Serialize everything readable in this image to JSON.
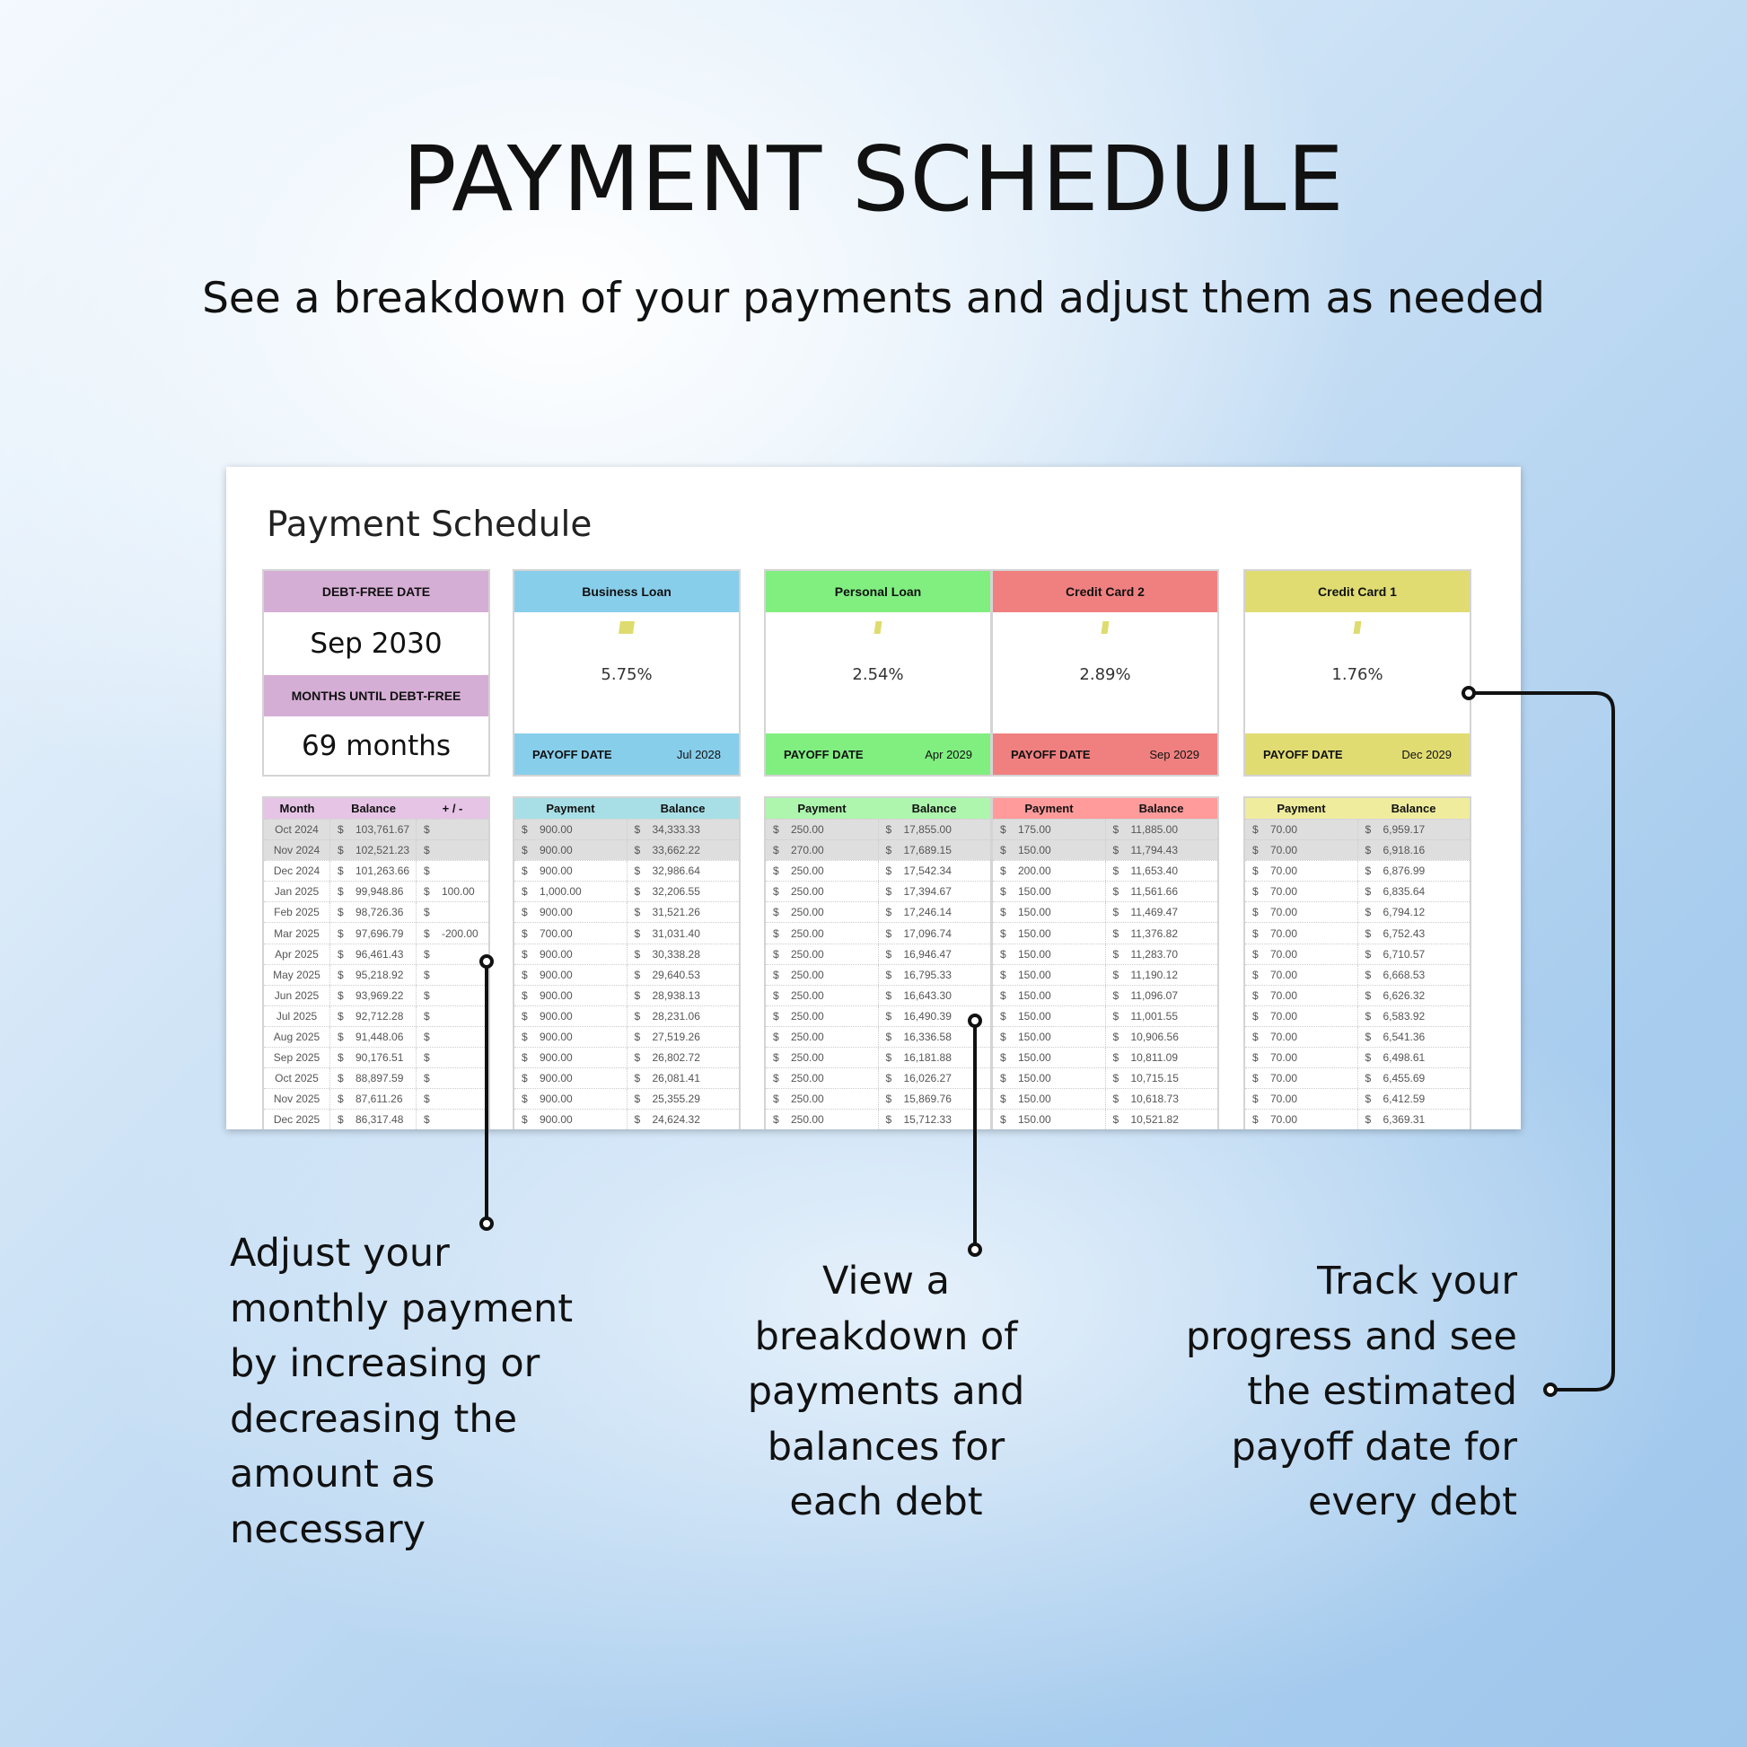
{
  "header": {
    "title": "PAYMENT SCHEDULE",
    "subtitle": "See a breakdown of your payments and adjust them as needed"
  },
  "sheet": {
    "title": "Payment Schedule",
    "summary": {
      "debt_free_label": "DEBT-FREE DATE",
      "debt_free_value": "Sep 2030",
      "months_label": "MONTHS UNTIL DEBT-FREE",
      "months_value": "69 months",
      "color": "#d5aed5",
      "table_color": "#e6c4e6"
    },
    "payoff_label": "PAYOFF DATE",
    "debts": [
      {
        "name": "Business Loan",
        "rate": "5.75%",
        "payoff": "Jul 2028",
        "color": "#87ceeb",
        "table_color": "#a8dfe6",
        "progress_gauge_color": "#dedc6e"
      },
      {
        "name": "Personal Loan",
        "rate": "2.54%",
        "payoff": "Apr 2029",
        "color": "#80ef80",
        "table_color": "#aef5ae",
        "progress_gauge_color": "#dedc6e"
      },
      {
        "name": "Credit Card 2",
        "rate": "2.89%",
        "payoff": "Sep 2029",
        "color": "#f08080",
        "table_color": "#ff9b9b",
        "progress_gauge_color": "#dedc6e"
      },
      {
        "name": "Credit Card 1",
        "rate": "1.76%",
        "payoff": "Dec 2029",
        "color": "#e0dc72",
        "table_color": "#efec9e",
        "progress_gauge_color": "#dedc6e"
      }
    ],
    "summary_table": {
      "headers": [
        "Month",
        "Balance",
        "+ / -"
      ],
      "currency": "$",
      "rows": [
        [
          "Oct 2024",
          "103,761.67",
          ""
        ],
        [
          "Nov 2024",
          "102,521.23",
          ""
        ],
        [
          "Dec 2024",
          "101,263.66",
          ""
        ],
        [
          "Jan 2025",
          "99,948.86",
          "100.00"
        ],
        [
          "Feb 2025",
          "98,726.36",
          ""
        ],
        [
          "Mar 2025",
          "97,696.79",
          "-200.00"
        ],
        [
          "Apr 2025",
          "96,461.43",
          ""
        ],
        [
          "May 2025",
          "95,218.92",
          ""
        ],
        [
          "Jun 2025",
          "93,969.22",
          ""
        ],
        [
          "Jul 2025",
          "92,712.28",
          ""
        ],
        [
          "Aug 2025",
          "91,448.06",
          ""
        ],
        [
          "Sep 2025",
          "90,176.51",
          ""
        ],
        [
          "Oct 2025",
          "88,897.59",
          ""
        ],
        [
          "Nov 2025",
          "87,611.26",
          ""
        ],
        [
          "Dec 2025",
          "86,317.48",
          ""
        ]
      ]
    },
    "debt_table_headers": [
      "Payment",
      "Balance"
    ],
    "debt_tables": [
      {
        "payments": [
          "900.00",
          "900.00",
          "900.00",
          "1,000.00",
          "900.00",
          "700.00",
          "900.00",
          "900.00",
          "900.00",
          "900.00",
          "900.00",
          "900.00",
          "900.00",
          "900.00",
          "900.00"
        ],
        "balances": [
          "34,333.33",
          "33,662.22",
          "32,986.64",
          "32,206.55",
          "31,521.26",
          "31,031.40",
          "30,338.28",
          "29,640.53",
          "28,938.13",
          "28,231.06",
          "27,519.26",
          "26,802.72",
          "26,081.41",
          "25,355.29",
          "24,624.32"
        ]
      },
      {
        "payments": [
          "250.00",
          "270.00",
          "250.00",
          "250.00",
          "250.00",
          "250.00",
          "250.00",
          "250.00",
          "250.00",
          "250.00",
          "250.00",
          "250.00",
          "250.00",
          "250.00",
          "250.00"
        ],
        "balances": [
          "17,855.00",
          "17,689.15",
          "17,542.34",
          "17,394.67",
          "17,246.14",
          "17,096.74",
          "16,946.47",
          "16,795.33",
          "16,643.30",
          "16,490.39",
          "16,336.58",
          "16,181.88",
          "16,026.27",
          "15,869.76",
          "15,712.33"
        ]
      },
      {
        "payments": [
          "175.00",
          "150.00",
          "200.00",
          "150.00",
          "150.00",
          "150.00",
          "150.00",
          "150.00",
          "150.00",
          "150.00",
          "150.00",
          "150.00",
          "150.00",
          "150.00",
          "150.00"
        ],
        "balances": [
          "11,885.00",
          "11,794.43",
          "11,653.40",
          "11,561.66",
          "11,469.47",
          "11,376.82",
          "11,283.70",
          "11,190.12",
          "11,096.07",
          "11,001.55",
          "10,906.56",
          "10,811.09",
          "10,715.15",
          "10,618.73",
          "10,521.82"
        ]
      },
      {
        "payments": [
          "70.00",
          "70.00",
          "70.00",
          "70.00",
          "70.00",
          "70.00",
          "70.00",
          "70.00",
          "70.00",
          "70.00",
          "70.00",
          "70.00",
          "70.00",
          "70.00",
          "70.00"
        ],
        "balances": [
          "6,959.17",
          "6,918.16",
          "6,876.99",
          "6,835.64",
          "6,794.12",
          "6,752.43",
          "6,710.57",
          "6,668.53",
          "6,626.32",
          "6,583.92",
          "6,541.36",
          "6,498.61",
          "6,455.69",
          "6,412.59",
          "6,369.31"
        ]
      }
    ],
    "row_highlight_color": "#dedede"
  },
  "callouts": {
    "left": [
      "Adjust your",
      "monthly payment",
      "by increasing or",
      "decreasing the",
      "amount as",
      "necessary"
    ],
    "middle": [
      "View a",
      "breakdown of",
      "payments and",
      "balances for",
      "each debt"
    ],
    "right": [
      "Track your",
      "progress and see",
      "the estimated",
      "payoff date for",
      "every debt"
    ]
  }
}
